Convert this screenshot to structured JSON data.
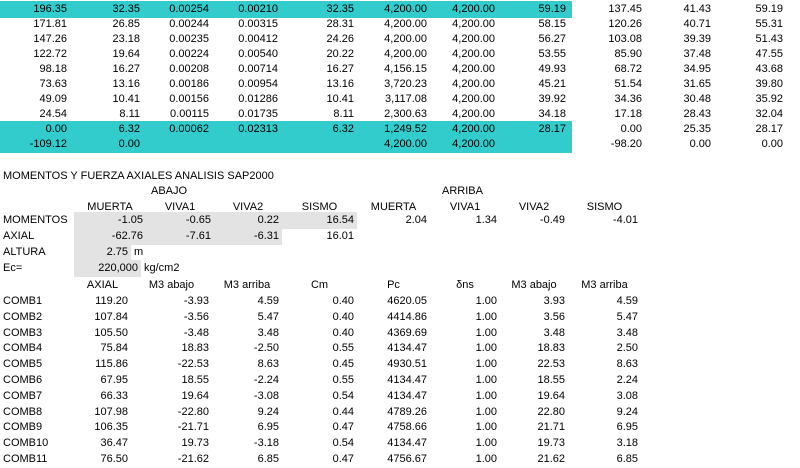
{
  "top_table": {
    "rows": [
      {
        "cells": [
          "196.35",
          "32.35",
          "0.00254",
          "0.00210",
          "32.35",
          "4,200.00",
          "4,200.00",
          "59.19",
          "137.45",
          "41.43",
          "59.19"
        ],
        "highlight": true
      },
      {
        "cells": [
          "171.81",
          "26.85",
          "0.00244",
          "0.00315",
          "28.31",
          "4,200.00",
          "4,200.00",
          "58.15",
          "120.26",
          "40.71",
          "55.31"
        ],
        "highlight": false
      },
      {
        "cells": [
          "147.26",
          "23.18",
          "0.00235",
          "0.00412",
          "24.26",
          "4,200.00",
          "4,200.00",
          "56.27",
          "103.08",
          "39.39",
          "51.43"
        ],
        "highlight": false
      },
      {
        "cells": [
          "122.72",
          "19.64",
          "0.00224",
          "0.00540",
          "20.22",
          "4,200.00",
          "4,200.00",
          "53.55",
          "85.90",
          "37.48",
          "47.55"
        ],
        "highlight": false
      },
      {
        "cells": [
          "98.18",
          "16.27",
          "0.00208",
          "0.00714",
          "16.27",
          "4,156.15",
          "4,200.00",
          "49.93",
          "68.72",
          "34.95",
          "43.68"
        ],
        "highlight": false
      },
      {
        "cells": [
          "73.63",
          "13.16",
          "0.00186",
          "0.00954",
          "13.16",
          "3,720.23",
          "4,200.00",
          "45.21",
          "51.54",
          "31.65",
          "39.80"
        ],
        "highlight": false
      },
      {
        "cells": [
          "49.09",
          "10.41",
          "0.00156",
          "0.01286",
          "10.41",
          "3,117.08",
          "4,200.00",
          "39.92",
          "34.36",
          "30.48",
          "35.92"
        ],
        "highlight": false
      },
      {
        "cells": [
          "24.54",
          "8.11",
          "0.00115",
          "0.01735",
          "8.11",
          "2,300.63",
          "4,200.00",
          "34.18",
          "17.18",
          "28.43",
          "32.04"
        ],
        "highlight": false
      },
      {
        "cells": [
          "0.00",
          "6.32",
          "0.00062",
          "0.02313",
          "6.32",
          "1,249.52",
          "4,200.00",
          "28.17",
          "0.00",
          "25.35",
          "28.17"
        ],
        "highlight": true
      },
      {
        "cells": [
          "-109.12",
          "0.00",
          "",
          "",
          "",
          "4,200.00",
          "4,200.00",
          "",
          "-98.20",
          "0.00",
          "0.00"
        ],
        "highlight": true
      }
    ]
  },
  "section_title": "MOMENTOS Y FUERZA AXIALES ANALISIS SAP2000",
  "group_headers": {
    "abajo": "ABAJO",
    "arriba": "ARRIBA"
  },
  "load_headers": [
    "MUERTA",
    "VIVA1",
    "VIVA2",
    "SISMO",
    "MUERTA",
    "VIVA1",
    "VIVA2",
    "SISMO"
  ],
  "momentos": {
    "label": "MOMENTOS",
    "values": [
      "-1.05",
      "-0.65",
      "0.22",
      "16.54",
      "2.04",
      "1.34",
      "-0.49",
      "-4.01"
    ]
  },
  "axial": {
    "label": "AXIAL",
    "values": [
      "-62.76",
      "-7.61",
      "-6.31",
      "16.01"
    ]
  },
  "altura": {
    "label": "ALTURA",
    "value": "2.75",
    "unit": "m"
  },
  "ec": {
    "label": "Ec=",
    "value": "220,000",
    "unit": "kg/cm2"
  },
  "comb_headers": [
    "AXIAL",
    "M3 abajo",
    "M3 arriba",
    "Cm",
    "Pc",
    "δns",
    "M3 abajo",
    "M3 arriba"
  ],
  "combs": [
    {
      "name": "COMB1",
      "values": [
        "119.20",
        "-3.93",
        "4.59",
        "0.40",
        "4620.05",
        "1.00",
        "3.93",
        "4.59"
      ]
    },
    {
      "name": "COMB2",
      "values": [
        "107.84",
        "-3.56",
        "5.47",
        "0.40",
        "4414.86",
        "1.00",
        "3.56",
        "5.47"
      ]
    },
    {
      "name": "COMB3",
      "values": [
        "105.50",
        "-3.48",
        "3.48",
        "0.40",
        "4369.69",
        "1.00",
        "3.48",
        "3.48"
      ]
    },
    {
      "name": "COMB4",
      "values": [
        "75.84",
        "18.83",
        "-2.50",
        "0.55",
        "4134.47",
        "1.00",
        "18.83",
        "2.50"
      ]
    },
    {
      "name": "COMB5",
      "values": [
        "115.86",
        "-22.53",
        "8.63",
        "0.45",
        "4930.51",
        "1.00",
        "22.53",
        "8.63"
      ]
    },
    {
      "name": "COMB6",
      "values": [
        "67.95",
        "18.55",
        "-2.24",
        "0.55",
        "4134.47",
        "1.00",
        "18.55",
        "2.24"
      ]
    },
    {
      "name": "COMB7",
      "values": [
        "66.33",
        "19.64",
        "-3.08",
        "0.54",
        "4134.47",
        "1.00",
        "19.64",
        "3.08"
      ]
    },
    {
      "name": "COMB8",
      "values": [
        "107.98",
        "-22.80",
        "9.24",
        "0.44",
        "4789.26",
        "1.00",
        "22.80",
        "9.24"
      ]
    },
    {
      "name": "COMB9",
      "values": [
        "106.35",
        "-21.71",
        "6.95",
        "0.47",
        "4758.66",
        "1.00",
        "21.71",
        "6.95"
      ]
    },
    {
      "name": "COMB10",
      "values": [
        "36.47",
        "19.73",
        "-3.18",
        "0.54",
        "4134.47",
        "1.00",
        "19.73",
        "3.18"
      ]
    },
    {
      "name": "COMB11",
      "values": [
        "76.50",
        "-21.62",
        "6.85",
        "0.47",
        "4756.67",
        "1.00",
        "21.62",
        "6.85"
      ]
    }
  ],
  "colors": {
    "highlight": "#33cccc",
    "input_gray": "#e3e3e3"
  }
}
